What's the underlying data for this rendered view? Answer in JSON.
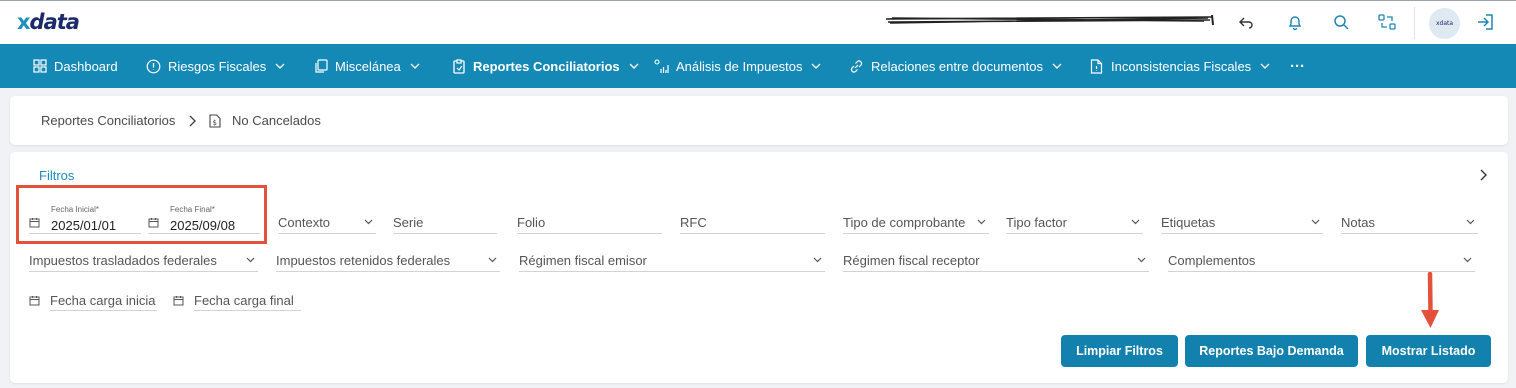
{
  "app": {
    "logo": "xdata"
  },
  "colors": {
    "primary": "#1589b6",
    "accent": "#1a8fbf",
    "highlight": "#e4513b",
    "button": "#1381ad"
  },
  "topbar": {
    "icons": [
      "undo-icon",
      "bell-icon",
      "search-icon",
      "swap-icon",
      "logout-icon"
    ],
    "avatar_text": "xdata"
  },
  "nav": {
    "items": [
      {
        "label": "Dashboard",
        "icon": "grid-icon",
        "dropdown": false
      },
      {
        "label": "Riesgos Fiscales",
        "icon": "alert-circle-icon",
        "dropdown": true
      },
      {
        "label": "Miscelánea",
        "icon": "copy-icon",
        "dropdown": true
      },
      {
        "label": "Reportes Conciliatorios",
        "icon": "clipboard-icon",
        "dropdown": true,
        "active": true
      },
      {
        "label": "Análisis de Impuestos",
        "icon": "bar-chart-icon",
        "dropdown": true
      },
      {
        "label": "Relaciones entre documentos",
        "icon": "link-icon",
        "dropdown": true
      },
      {
        "label": "Inconsistencias Fiscales",
        "icon": "file-icon",
        "dropdown": true
      }
    ],
    "more": "···"
  },
  "breadcrumb": {
    "root": "Reportes Conciliatorios",
    "current": "No Cancelados",
    "current_icon": "document-dollar-icon"
  },
  "filters": {
    "title": "Filtros",
    "fecha_inicial": {
      "label": "Fecha Inicial*",
      "value": "2025/01/01"
    },
    "fecha_final": {
      "label": "Fecha Final*",
      "value": "2025/09/08"
    },
    "row1": {
      "contexto": "Contexto",
      "serie": "Serie",
      "folio": "Folio",
      "rfc": "RFC",
      "tipo_comprobante": "Tipo de comprobante",
      "tipo_factor": "Tipo factor",
      "etiquetas": "Etiquetas",
      "notas": "Notas"
    },
    "row2": {
      "traslados": "Impuestos trasladados federales",
      "retenidos": "Impuestos retenidos federales",
      "regimen_emisor": "Régimen fiscal emisor",
      "regimen_receptor": "Régimen fiscal receptor",
      "complementos": "Complementos"
    },
    "row3": {
      "carga_inicial": "Fecha carga inicia",
      "carga_final": "Fecha carga final"
    }
  },
  "buttons": {
    "limpiar": "Limpiar Filtros",
    "bajo_demanda": "Reportes Bajo Demanda",
    "mostrar": "Mostrar Listado"
  }
}
